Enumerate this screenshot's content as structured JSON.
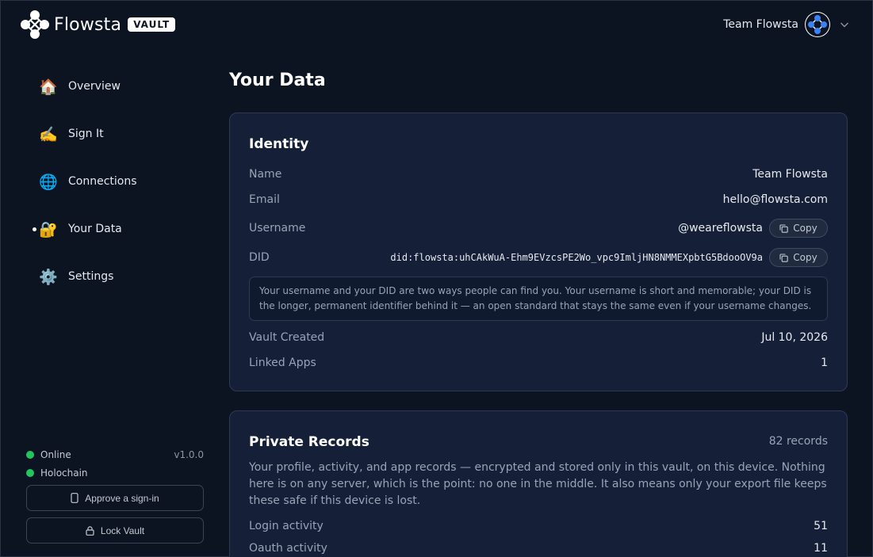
{
  "brand": {
    "name": "Flowsta",
    "badge": "VAULT"
  },
  "account": {
    "name": "Team Flowsta"
  },
  "sidebar": {
    "items": [
      {
        "icon": "🏠",
        "label": "Overview"
      },
      {
        "icon": "✍️",
        "label": "Sign It"
      },
      {
        "icon": "🌐",
        "label": "Connections"
      },
      {
        "icon": "🔐",
        "label": "Your Data",
        "active": true
      },
      {
        "icon": "⚙️",
        "label": "Settings"
      }
    ],
    "status": {
      "online": "Online",
      "version": "v1.0.0",
      "holochain": "Holochain"
    },
    "approve_label": "Approve a sign-in",
    "lock_label": "Lock Vault"
  },
  "main": {
    "title": "Your Data",
    "identity": {
      "heading": "Identity",
      "name_label": "Name",
      "name_value": "Team Flowsta",
      "email_label": "Email",
      "email_value": "hello@flowsta.com",
      "username_label": "Username",
      "username_value": "@weareflowsta",
      "did_label": "DID",
      "did_value": "did:flowsta:uhCAkWuA-Ehm9EVzcsPE2Wo_vpc9ImljHN8NMMEXpbtG5BdooOV9a",
      "copy_label": "Copy",
      "note": "Your username and your DID are two ways people can find you. Your username is short and memorable; your DID is the longer, permanent identifier behind it — an open standard that stays the same even if your username changes.",
      "created_label": "Vault Created",
      "created_value": "Jul 10, 2026",
      "linked_label": "Linked Apps",
      "linked_value": "1"
    },
    "records": {
      "heading": "Private Records",
      "count": "82 records",
      "description": "Your profile, activity, and app records — encrypted and stored only in this vault, on this device. Nothing here is on any server, which is the point: no one in the middle. It also means only your export file keeps these safe if this device is lost.",
      "rows": [
        {
          "label": "Login activity",
          "value": "51"
        },
        {
          "label": "Oauth activity",
          "value": "11"
        }
      ]
    }
  },
  "colors": {
    "background": "#0d1421",
    "card": "#152038",
    "online": "#22c55e",
    "accent": "#3b82f6"
  }
}
